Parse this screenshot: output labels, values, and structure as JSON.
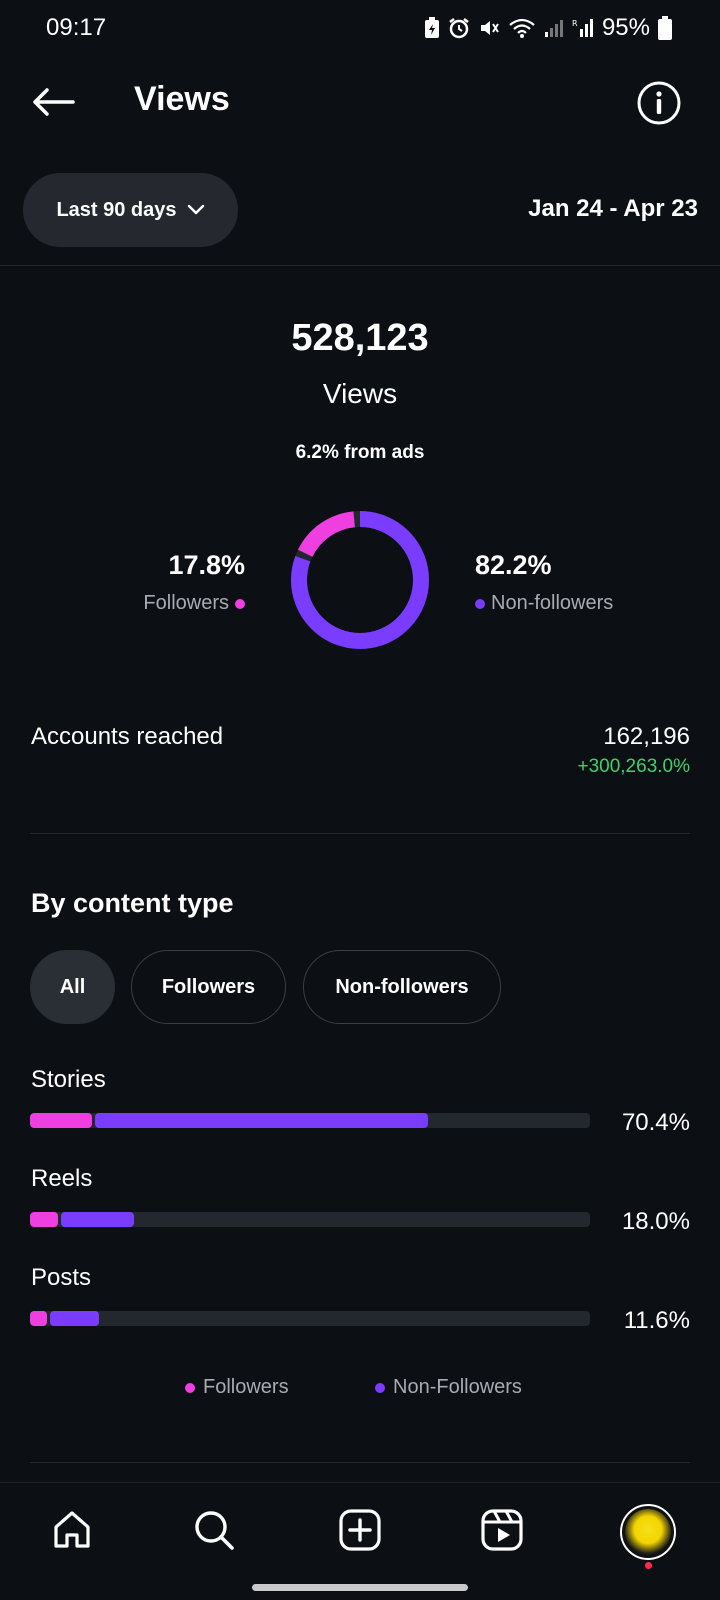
{
  "status_bar": {
    "time": "09:17",
    "battery": "95%"
  },
  "header": {
    "title": "Views"
  },
  "filter": {
    "range_label": "Last 90 days",
    "date_range": "Jan 24 - Apr 23"
  },
  "summary": {
    "total": "528,123",
    "label": "Views",
    "ads_note": "6.2% from ads",
    "followers_pct": "17.8%",
    "followers_label": "Followers",
    "non_followers_pct": "82.2%",
    "non_followers_label": "Non-followers"
  },
  "donut": {
    "followers_fraction": 0.178,
    "non_followers_fraction": 0.822
  },
  "accounts_reached": {
    "label": "Accounts reached",
    "value": "162,196",
    "change": "+300,263.0%"
  },
  "content_type": {
    "title": "By content type",
    "chips": [
      "All",
      "Followers",
      "Non-followers"
    ],
    "selected_chip": "All",
    "rows": [
      {
        "label": "Stories",
        "pct": "70.4%",
        "followers_share": 0.11,
        "non_followers_share": 0.595
      },
      {
        "label": "Reels",
        "pct": "18.0%",
        "followers_share": 0.05,
        "non_followers_share": 0.13
      },
      {
        "label": "Posts",
        "pct": "11.6%",
        "followers_share": 0.03,
        "non_followers_share": 0.088
      }
    ],
    "legend": {
      "followers": "Followers",
      "non_followers": "Non-Followers"
    }
  },
  "colors": {
    "followers": "#ef3fe0",
    "non_followers": "#7a3cff",
    "positive": "#3fd16b"
  },
  "bottom_nav": {
    "items": [
      "home-icon",
      "search-icon",
      "create-icon",
      "reels-icon",
      "profile-avatar"
    ]
  }
}
